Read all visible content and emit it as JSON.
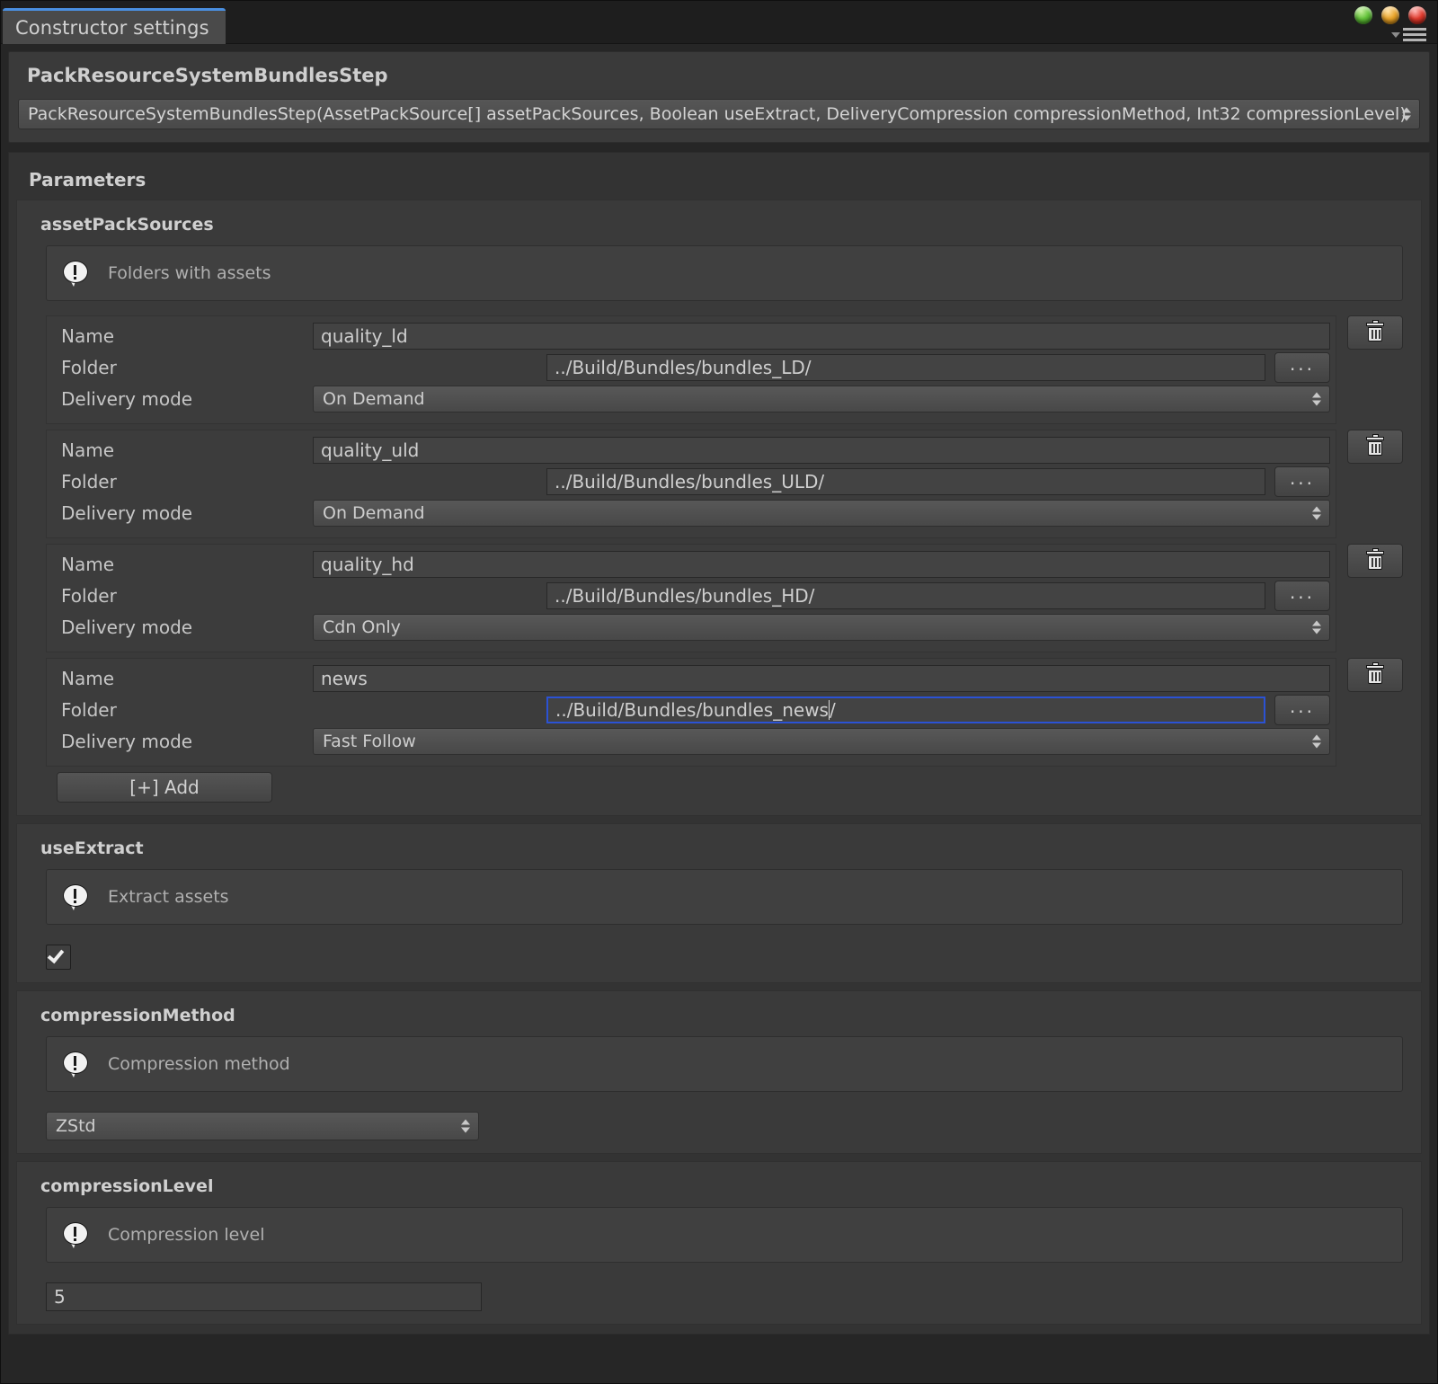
{
  "window": {
    "tab_label": "Constructor settings",
    "controls": {
      "minimize": "green-orb",
      "maximize": "orange-orb",
      "close": "red-orb",
      "menu": "hamburger-menu-icon"
    }
  },
  "header": {
    "title": "PackResourceSystemBundlesStep",
    "signature": "PackResourceSystemBundlesStep(AssetPackSource[] assetPackSources, Boolean useExtract, DeliveryCompression compressionMethod, Int32 compressionLevel)"
  },
  "parameters": {
    "title": "Parameters",
    "sections": [
      {
        "name": "assetPackSources",
        "help": "Folders with assets",
        "add_label": "[+] Add",
        "labels": {
          "name": "Name",
          "folder": "Folder",
          "delivery": "Delivery mode"
        },
        "browse_label": "...",
        "rows": [
          {
            "name": "quality_ld",
            "folder": "../Build/Bundles/bundles_LD/",
            "delivery": "On Demand",
            "focused": false
          },
          {
            "name": "quality_uld",
            "folder": "../Build/Bundles/bundles_ULD/",
            "delivery": "On Demand",
            "focused": false
          },
          {
            "name": "quality_hd",
            "folder": "../Build/Bundles/bundles_HD/",
            "delivery": "Cdn Only",
            "focused": false
          },
          {
            "name": "news",
            "folder": "../Build/Bundles/bundles_news/",
            "delivery": "Fast Follow",
            "focused": true
          }
        ]
      },
      {
        "name": "useExtract",
        "help": "Extract assets",
        "checkbox_checked": true
      },
      {
        "name": "compressionMethod",
        "help": "Compression method",
        "value": "ZStd"
      },
      {
        "name": "compressionLevel",
        "help": "Compression level",
        "value": "5"
      }
    ]
  },
  "colors": {
    "accent_focus": "#2b52d4",
    "tab_highlight": "#4a8fe0",
    "panel": "#3a3a3a",
    "background": "#262626"
  }
}
